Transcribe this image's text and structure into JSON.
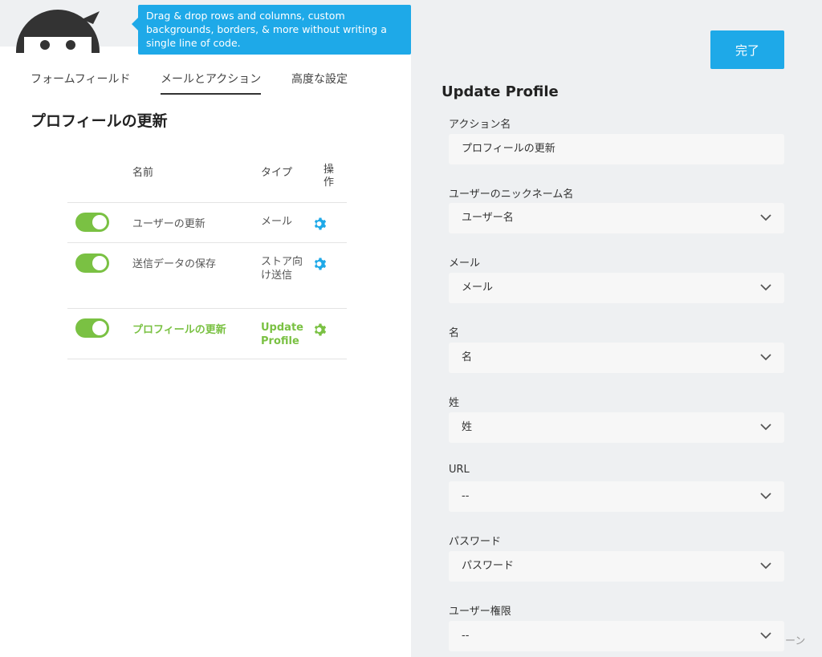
{
  "tooltip": {
    "text": "Drag & drop rows and columns, custom backgrounds, borders, & more without writing a single line of code."
  },
  "tabs": [
    {
      "label": "フォームフィールド"
    },
    {
      "label": "メールとアクション"
    },
    {
      "label": "高度な設定"
    }
  ],
  "action_list": {
    "title": "プロフィールの更新",
    "headers": {
      "name": "名前",
      "type": "タイプ",
      "actions": "操作"
    },
    "rows": [
      {
        "name": "ユーザーの更新",
        "type": "メール",
        "enabled": true
      },
      {
        "name": "送信データの保存",
        "type": "ストア向け送信",
        "enabled": true
      },
      {
        "name": "プロフィールの更新",
        "type": "Update Profile",
        "enabled": true
      }
    ]
  },
  "settings": {
    "done_label": "完了",
    "title": "Update Profile",
    "fields": [
      {
        "label": "アクション名",
        "value": "プロフィールの更新"
      },
      {
        "label": "ユーザーのニックネーム名",
        "value": "ユーザー名"
      },
      {
        "label": "メール",
        "value": "メール"
      },
      {
        "label": "名",
        "value": "名"
      },
      {
        "label": "姓",
        "value": "姓"
      },
      {
        "label": "URL",
        "value": "--"
      },
      {
        "label": "パスワード",
        "value": "パスワード"
      },
      {
        "label": "ユーザー権限",
        "value": "--"
      }
    ],
    "side_text": "ーン"
  },
  "colors": {
    "accent": "#1ea9e8",
    "active_green": "#7ac143",
    "panel_bg": "#eef0f2"
  },
  "icons": {
    "logo": "ninja-logo-icon",
    "gear": "gear-icon",
    "chevron": "chevron-down-icon"
  }
}
